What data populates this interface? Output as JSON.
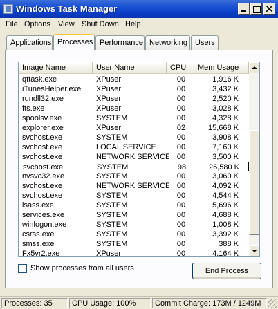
{
  "window": {
    "title": "Windows Task Manager",
    "controls": [
      "minimize",
      "maximize",
      "close"
    ]
  },
  "menu": [
    "File",
    "Options",
    "View",
    "Shut Down",
    "Help"
  ],
  "tabs": [
    {
      "label": "Applications",
      "active": false
    },
    {
      "label": "Processes",
      "active": true
    },
    {
      "label": "Performance",
      "active": false
    },
    {
      "label": "Networking",
      "active": false
    },
    {
      "label": "Users",
      "active": false
    }
  ],
  "process_table": {
    "columns": [
      "Image Name",
      "User Name",
      "CPU",
      "Mem Usage"
    ],
    "rows": [
      {
        "name": "qttask.exe",
        "user": "XPuser",
        "cpu": "00",
        "mem": "1,916 K"
      },
      {
        "name": "iTunesHelper.exe",
        "user": "XPuser",
        "cpu": "00",
        "mem": "3,432 K"
      },
      {
        "name": "rundll32.exe",
        "user": "XPuser",
        "cpu": "00",
        "mem": "2,520 K"
      },
      {
        "name": "fts.exe",
        "user": "XPuser",
        "cpu": "00",
        "mem": "3,028 K"
      },
      {
        "name": "spoolsv.exe",
        "user": "SYSTEM",
        "cpu": "00",
        "mem": "4,328 K"
      },
      {
        "name": "explorer.exe",
        "user": "XPuser",
        "cpu": "02",
        "mem": "15,668 K"
      },
      {
        "name": "svchost.exe",
        "user": "SYSTEM",
        "cpu": "00",
        "mem": "3,908 K"
      },
      {
        "name": "svchost.exe",
        "user": "LOCAL SERVICE",
        "cpu": "00",
        "mem": "7,160 K"
      },
      {
        "name": "svchost.exe",
        "user": "NETWORK SERVICE",
        "cpu": "00",
        "mem": "3,500 K"
      },
      {
        "name": "svchost.exe",
        "user": "SYSTEM",
        "cpu": "98",
        "mem": "26,580 K",
        "selected": true
      },
      {
        "name": "nvsvc32.exe",
        "user": "SYSTEM",
        "cpu": "00",
        "mem": "3,060 K"
      },
      {
        "name": "svchost.exe",
        "user": "NETWORK SERVICE",
        "cpu": "00",
        "mem": "4,092 K"
      },
      {
        "name": "svchost.exe",
        "user": "SYSTEM",
        "cpu": "00",
        "mem": "4,544 K"
      },
      {
        "name": "lsass.exe",
        "user": "SYSTEM",
        "cpu": "00",
        "mem": "5,696 K"
      },
      {
        "name": "services.exe",
        "user": "SYSTEM",
        "cpu": "00",
        "mem": "4,688 K"
      },
      {
        "name": "winlogon.exe",
        "user": "SYSTEM",
        "cpu": "00",
        "mem": "1,008 K"
      },
      {
        "name": "csrss.exe",
        "user": "SYSTEM",
        "cpu": "00",
        "mem": "3,392 K"
      },
      {
        "name": "smss.exe",
        "user": "SYSTEM",
        "cpu": "00",
        "mem": "388 K"
      },
      {
        "name": "Fx5vr2.exe",
        "user": "XPuser",
        "cpu": "00",
        "mem": "4,164 K"
      }
    ]
  },
  "show_all_checkbox": {
    "label": "Show processes from all users",
    "checked": false
  },
  "end_process_button": "End Process",
  "status": {
    "processes": "Processes: 35",
    "cpu_usage": "CPU Usage: 100%",
    "commit_charge": "Commit Charge: 173M / 1249M"
  },
  "colors": {
    "titlebar": "#0a3fc7",
    "active_tab_accent": "#ffc83c",
    "window_face": "#ece9d8"
  }
}
